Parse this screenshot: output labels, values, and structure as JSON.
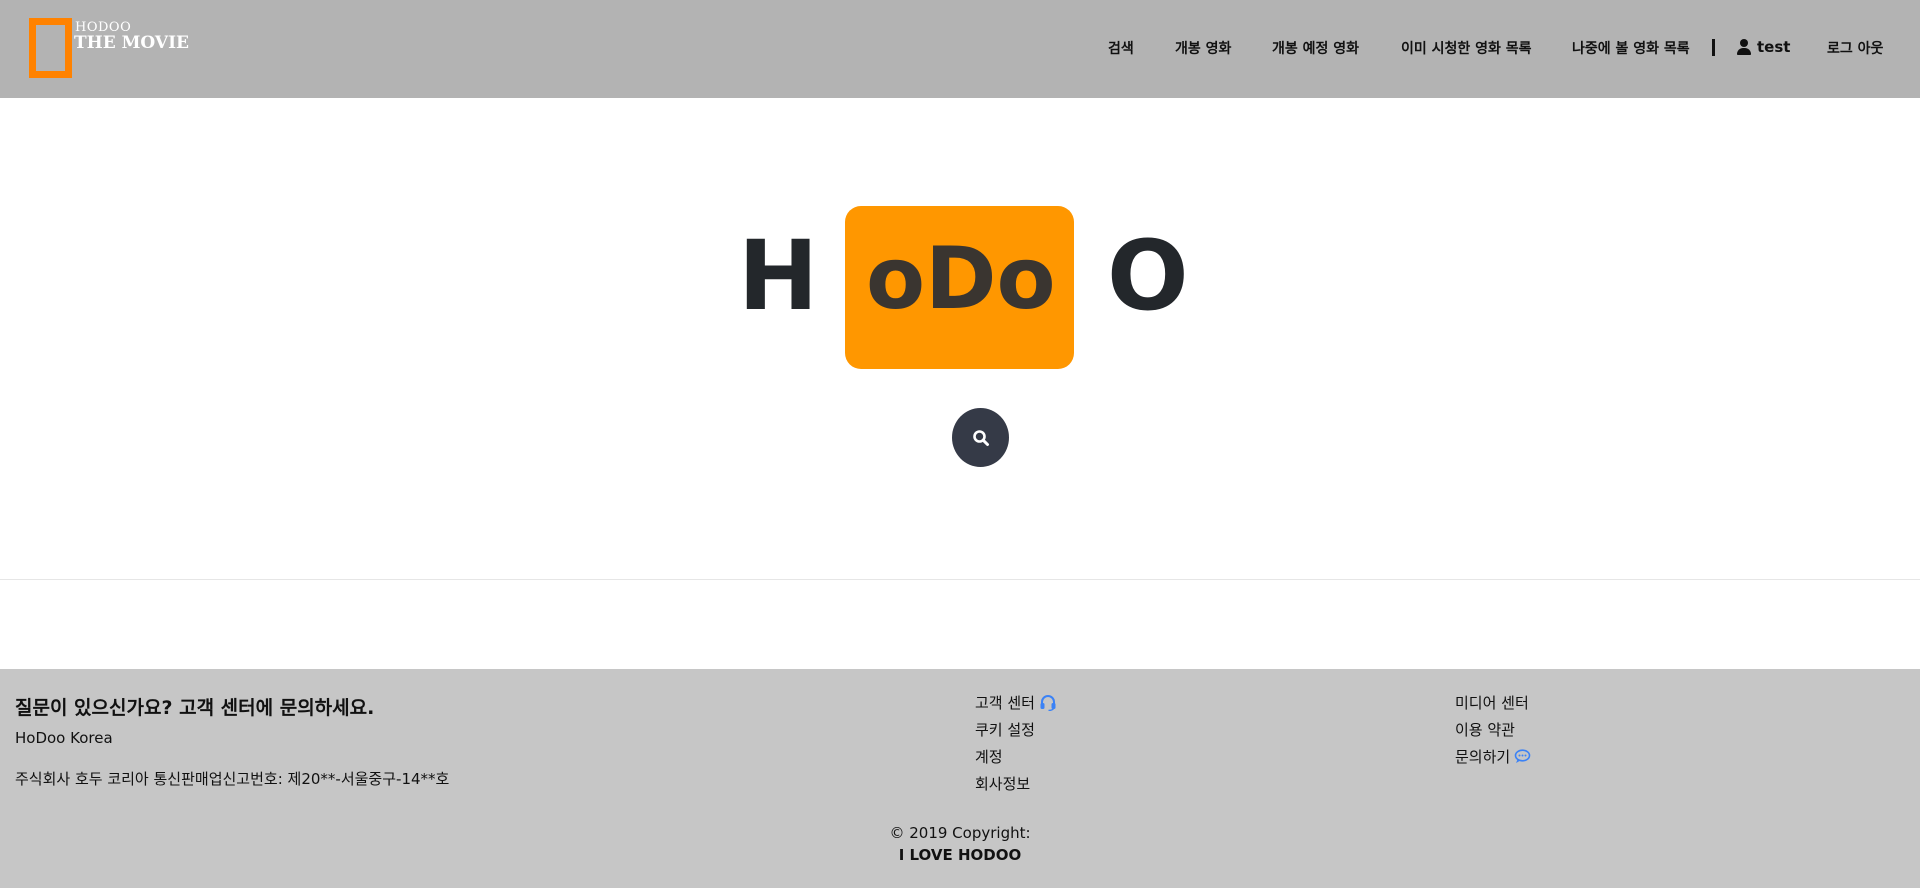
{
  "logo": {
    "small": "HODOO",
    "big": "THE MOVIE"
  },
  "nav": {
    "search": "검색",
    "now_showing": "개봉 영화",
    "upcoming": "개봉 예정 영화",
    "watched": "이미 시청한 영화 목록",
    "watch_later": "나중에 볼 영화 목록",
    "username": "test",
    "logout": "로그 아웃"
  },
  "hero": {
    "left": "H",
    "middle": "oDo",
    "right": "O"
  },
  "footer": {
    "title": "질문이 있으신가요? 고객 센터에 문의하세요.",
    "company": "HoDoo Korea",
    "address": "주식회사 호두 코리아 통신판매업신고번호: 제20**-서울중구-14**호",
    "col2": {
      "support": "고객 센터",
      "cookies": "쿠키 설정",
      "account": "계정",
      "company_info": "회사정보"
    },
    "col3": {
      "media": "미디어 센터",
      "terms": "이용 약관",
      "inquiry": "문의하기"
    },
    "copyright": "© 2019 Copyright:",
    "tagline": "I LOVE HODOO"
  },
  "colors": {
    "accent": "#ff9700",
    "header_bg": "#b3b3b3",
    "footer_bg": "#c6c6c6",
    "search_btn": "#353a47",
    "icon_blue": "#3b82f6"
  },
  "icons": {
    "user": "user-icon",
    "search": "search-icon",
    "headset": "headset-icon",
    "chat": "chat-bubble-icon"
  }
}
